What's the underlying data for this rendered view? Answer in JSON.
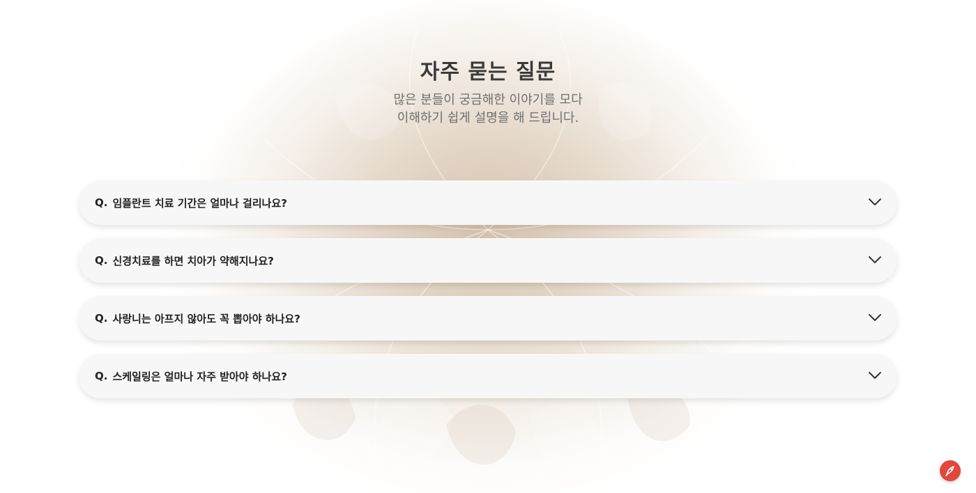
{
  "section": {
    "title": "자주 묻는 질문",
    "subtitle_line1": "많은 분들이 궁금해한 이야기를 모다",
    "subtitle_line2": "이해하기 쉽게 설명을 해 드립니다."
  },
  "faq": {
    "prefix": "Q.",
    "items": [
      {
        "question": "임플란트 치료 기간은 얼마나 걸리나요?"
      },
      {
        "question": "신경치료를 하면 치아가 약해지나요?"
      },
      {
        "question": "사랑니는 아프지 않아도 꼭 뽑아야 하나요?"
      },
      {
        "question": "스케일링은 얼마나 자주 받아야 하나요?"
      }
    ]
  },
  "icons": {
    "expand": "chevron-down-icon",
    "floating": "rocket-icon"
  },
  "colors": {
    "accent": "#e1473d",
    "card_bg": "#f7f7f7",
    "title": "#3a3a3a",
    "subtitle": "#6f6f6f"
  }
}
